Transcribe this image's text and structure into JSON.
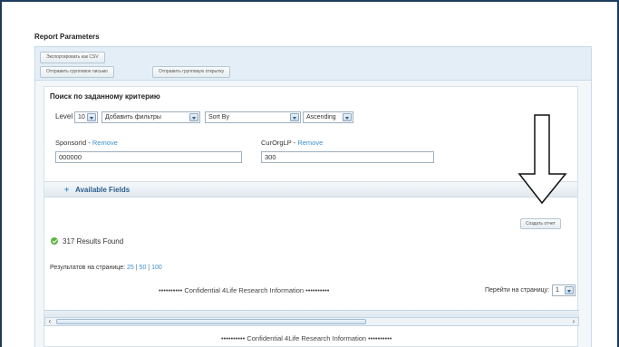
{
  "report": {
    "title": "Report Parameters"
  },
  "toolbar": {
    "export_csv": "Экспортировать как CSV",
    "send_group_letter": "Отправить групповое письмо",
    "send_group_postcard": "Отправить групповую открытку"
  },
  "search": {
    "heading": "Поиск по заданному критерию",
    "level_label": "Level",
    "level_value": "10",
    "filters_value": "Добавить фильтры",
    "sort_value": "Sort By",
    "order_value": "Ascending"
  },
  "fields": [
    {
      "name": "SponsorId",
      "remove": "Remove",
      "value": "000000"
    },
    {
      "name": "CurOrgLP",
      "remove": "Remove",
      "value": "300"
    }
  ],
  "available_fields": {
    "label": "Available Fields"
  },
  "create_report": "Создать отчет",
  "results": {
    "found": "317 Results Found",
    "per_page_label": "Результатов на странице:",
    "per_page_options": [
      "25",
      "50",
      "100"
    ],
    "goto_label": "Перейти на страницу:",
    "goto_value": "1"
  },
  "confidential": "•••••••••• Confidential 4Life Research Information ••••••••••",
  "colors": {
    "accent_blue": "#3a8fd0",
    "toolbar_bg": "#e3eef6",
    "success_green": "#5fb247",
    "frame": "#1f3b5c"
  },
  "icons": {
    "plus": "plus-icon",
    "success": "check-circle-icon",
    "annotation": "down-arrow-icon"
  }
}
